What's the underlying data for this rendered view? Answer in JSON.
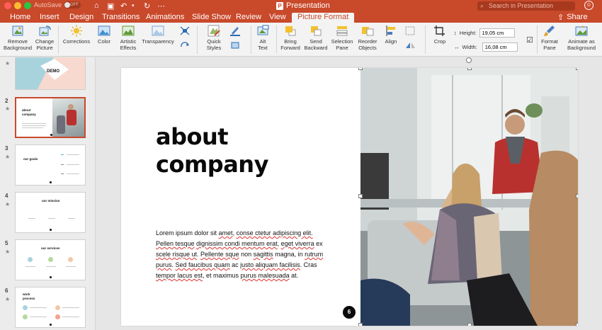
{
  "titlebar": {
    "autosave_label": "AutoSave",
    "autosave_state": "OFF",
    "document_title": "Presentation",
    "doc_badge": "P",
    "search_placeholder": "Search in Presentation"
  },
  "tabs": [
    {
      "label": "Home"
    },
    {
      "label": "Insert"
    },
    {
      "label": "Design"
    },
    {
      "label": "Transitions"
    },
    {
      "label": "Animations"
    },
    {
      "label": "Slide Show"
    },
    {
      "label": "Review"
    },
    {
      "label": "View"
    },
    {
      "label": "Picture Format",
      "active": true
    }
  ],
  "share_label": "Share",
  "ribbon": {
    "remove_background": "Remove\nBackground",
    "change_picture": "Change\nPicture",
    "corrections": "Corrections",
    "color": "Color",
    "artistic_effects": "Artistic\nEffects",
    "transparency": "Transparency",
    "quick_styles": "Quick\nStyles",
    "alt_text": "Alt\nText",
    "bring_forward": "Bring\nForward",
    "send_backward": "Send\nBackward",
    "selection_pane": "Selection\nPane",
    "reorder_objects": "Reorder\nObjects",
    "align": "Align",
    "crop": "Crop",
    "height_label": "Height:",
    "height_value": "19,05 cm",
    "width_label": "Width:",
    "width_value": "16,08 cm",
    "format_pane": "Format\nPane",
    "animate_as_background": "Animate as\nBackground"
  },
  "slides_panel": [
    {
      "number": "1",
      "title": "DEMO"
    },
    {
      "number": "2",
      "title": "about company"
    },
    {
      "number": "3",
      "title": "our goals"
    },
    {
      "number": "4",
      "title": "our mission"
    },
    {
      "number": "5",
      "title": "our services"
    },
    {
      "number": "6",
      "title": "work process"
    }
  ],
  "slide": {
    "title_line1": "about",
    "title_line2": "company",
    "body": {
      "l1a": "Lorem ipsum dolor sit ",
      "l1b": "amet",
      "l1c": ", ",
      "l1d": "conse ctetur adipiscing elit.",
      "l2a": "Pellen tesque",
      "l2b": " ",
      "l2c": "dignissim condi mentum erat",
      "l2d": ", ",
      "l2e": "eget viverra",
      "l2f": " ex",
      "l3a": "scele risque ut",
      "l3b": ". ",
      "l3c": "Pellente sque",
      "l3d": " non ",
      "l3e": "sagittis",
      "l3f": " magna, in ",
      "l3g": "rutrum",
      "l4a": "purus",
      "l4b": ". ",
      "l4c": "Sed faucibus quam",
      "l4d": " ac ",
      "l4e": "justo aliquam facilisis",
      "l4f": ". Cras",
      "l5a": "tempor lacus est",
      "l5b": ", et maximus ",
      "l5c": "purus malesuada",
      "l5d": " at."
    },
    "page_number": "6"
  },
  "colors": {
    "accent": "#c9492b",
    "ribbon_bg": "#f3f3f3",
    "panel_bg": "#ececec"
  }
}
